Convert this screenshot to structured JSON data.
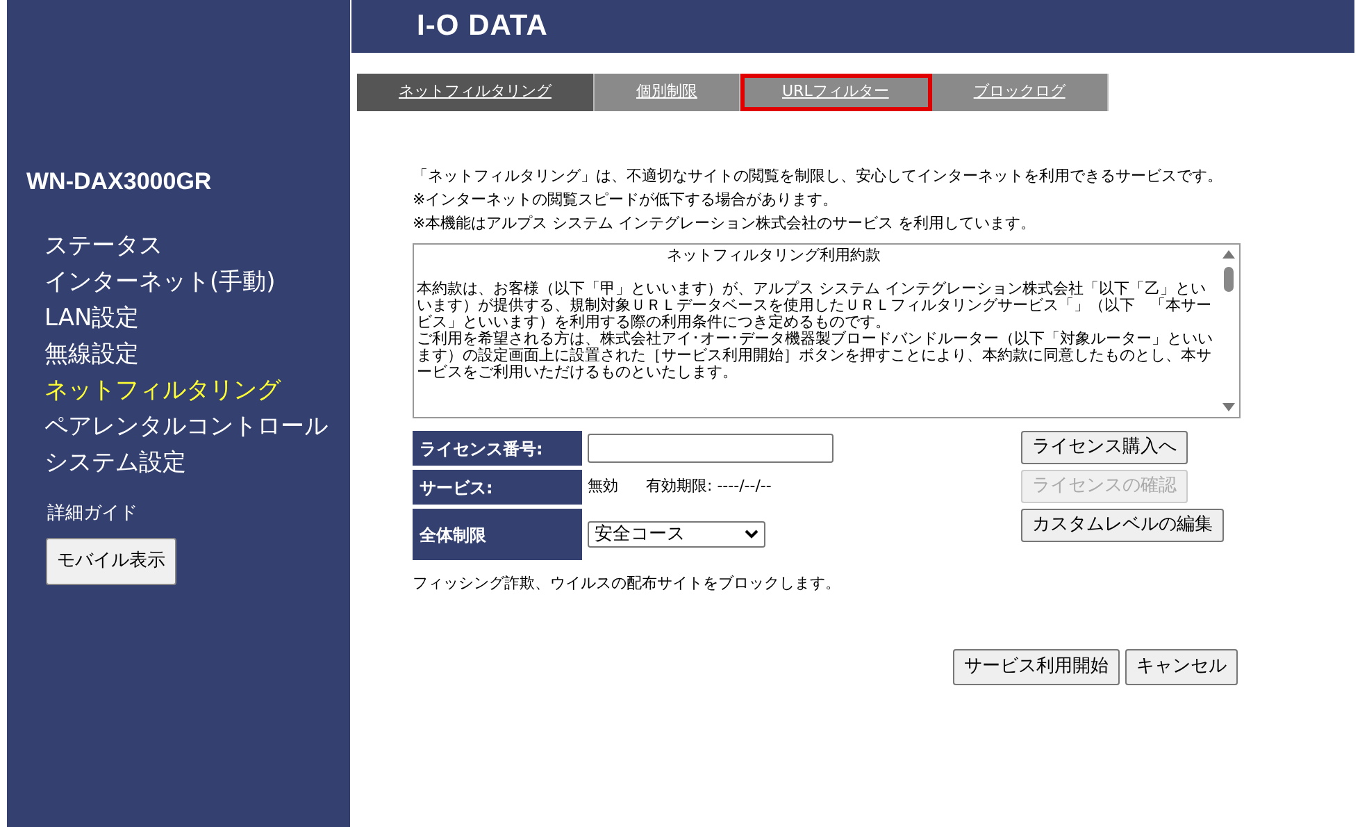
{
  "sidebar": {
    "model": "WN-DAX3000GR",
    "items": [
      {
        "label": "ステータス",
        "selected": false
      },
      {
        "label": "インターネット(手動)",
        "selected": false
      },
      {
        "label": "LAN設定",
        "selected": false
      },
      {
        "label": "無線設定",
        "selected": false
      },
      {
        "label": "ネットフィルタリング",
        "selected": true
      },
      {
        "label": "ペアレンタルコントロール",
        "selected": false
      },
      {
        "label": "システム設定",
        "selected": false
      }
    ],
    "guide": "詳細ガイド",
    "mobile_button": "モバイル表示"
  },
  "header": {
    "logo": "I-O DATA"
  },
  "tabs": [
    {
      "label": "ネットフィルタリング",
      "selected": true,
      "highlighted": false
    },
    {
      "label": "個別制限",
      "selected": false,
      "highlighted": false
    },
    {
      "label": "URLフィルター",
      "selected": false,
      "highlighted": true
    },
    {
      "label": "ブロックログ",
      "selected": false,
      "highlighted": false
    }
  ],
  "intro": [
    "「ネットフィルタリング」は、不適切なサイトの閲覧を制限し、安心してインターネットを利用できるサービスです。",
    "※インターネットの閲覧スピードが低下する場合があります。",
    "※本機能はアルプス システム インテグレーション株式会社のサービス を利用しています。"
  ],
  "terms": {
    "title": "ネットフィルタリング利用約款",
    "paragraphs": [
      "本約款は、お客様（以下「甲」といいます）が、アルプス システム インテグレーション株式会社「以下「乙」といいます）が提供する、規制対象ＵＲＬデータベースを使用したＵＲＬフィルタリングサービス「」（以下　「本サービス」といいます）を利用する際の利用条件につき定めるものです。",
      "ご利用を希望される方は、株式会社アイ･オー･データ機器製ブロードバンドルーター（以下「対象ルーター」といいます）の設定画面上に設置された［サービス利用開始］ボタンを押すことにより、本約款に同意したものとし、本サービスをご利用いただけるものといたします。"
    ]
  },
  "form": {
    "license_label": "ライセンス番号:",
    "service_label": "サービス:",
    "service_status": "無効",
    "expiry": "有効期限: ----/--/--",
    "restriction_label": "全体制限",
    "restriction_value": "安全コース",
    "description": "フィッシング詐欺、ウイルスの配布サイトをブロックします。"
  },
  "side_buttons": [
    {
      "label": "ライセンス購入へ",
      "disabled": false
    },
    {
      "label": "ライセンスの確認",
      "disabled": true
    },
    {
      "label": "カスタムレベルの編集",
      "disabled": false
    }
  ],
  "bottom_buttons": [
    "サービス利用開始",
    "キャンセル"
  ]
}
